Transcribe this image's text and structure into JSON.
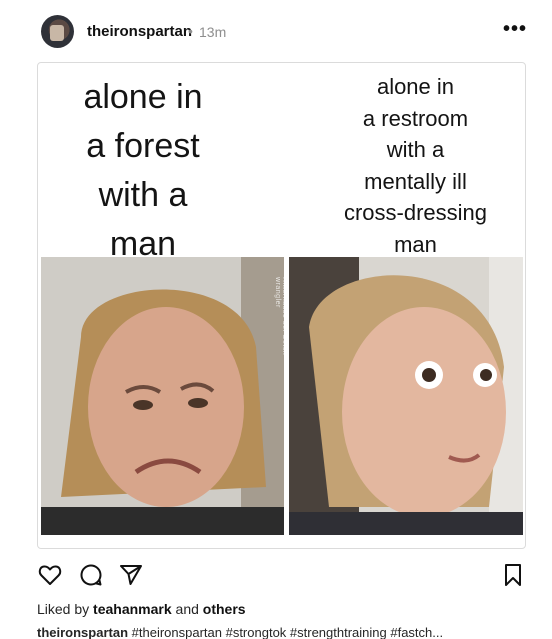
{
  "post": {
    "username": "theironspartan",
    "separator": "•",
    "time_ago": "13m",
    "more_icon": "ellipsis-icon"
  },
  "meme": {
    "left_caption": "alone in\na forest\nwith a\nman",
    "right_caption": "alone in\na restroom\nwith a\nmentally ill\ncross-dressing\nman",
    "watermark": "Ritterhause del Gotch wrangler"
  },
  "actions": {
    "like_icon": "heart-icon",
    "comment_icon": "comment-icon",
    "share_icon": "send-icon",
    "save_icon": "bookmark-icon"
  },
  "likes": {
    "prefix": "Liked by",
    "user": "teahanmark",
    "joiner": "and",
    "others": "others"
  },
  "caption": {
    "username": "theironspartan",
    "text": "#theironspartan #strongtok #strengthtraining #fastch..."
  },
  "colors": {
    "text": "#262626",
    "muted": "#8e8e8e",
    "border": "#dbdbdb"
  }
}
